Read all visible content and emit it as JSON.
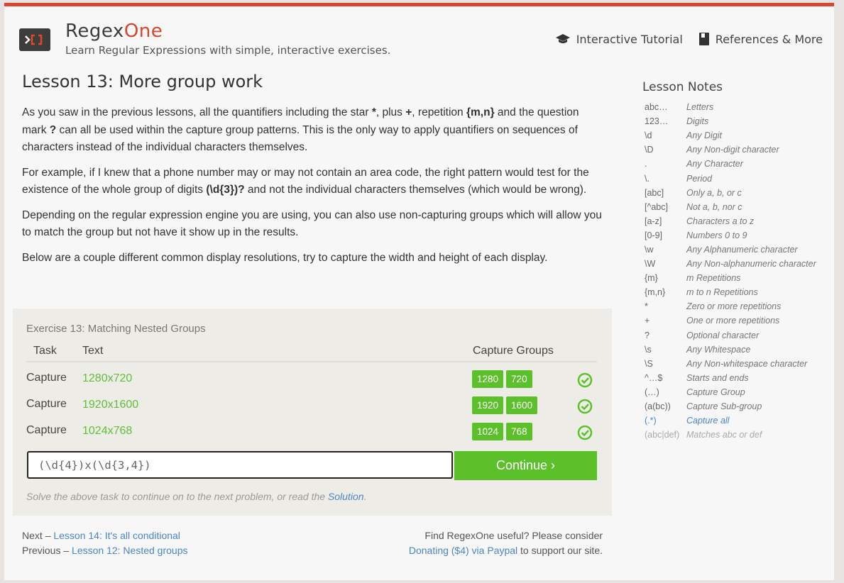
{
  "header": {
    "brand_prefix": "Regex",
    "brand_suffix": "One",
    "tagline": "Learn Regular Expressions with simple, interactive exercises.",
    "nav": [
      {
        "label": "Interactive Tutorial",
        "icon": "graduation-cap-icon"
      },
      {
        "label": "References & More",
        "icon": "book-icon"
      }
    ]
  },
  "lesson": {
    "title": "Lesson 13: More group work",
    "p1": {
      "a": "As you saw in the previous lessons, all the quantifiers including the star ",
      "b1": "*",
      "c": ", plus ",
      "b2": "+",
      "d": ", repetition ",
      "b3": "{m,n}",
      "e": " and the question mark ",
      "b4": "?",
      "f": " can all be used within the capture group patterns. This is the only way to apply quantifiers on sequences of characters instead of the individual characters themselves."
    },
    "p2": {
      "a": "For example, if I knew that a phone number may or may not contain an area code, the right pattern would test for the existence of the whole group of digits ",
      "b": "(\\d{3})?",
      "c": " and not the individual characters themselves (which would be wrong)."
    },
    "p3": "Depending on the regular expression engine you are using, you can also use non-capturing groups which will allow you to match the group but not have it show up in the results.",
    "p4": "Below are a couple different common display resolutions, try to capture the width and height of each display."
  },
  "exercise": {
    "title": "Exercise 13: Matching Nested Groups",
    "col_task": "Task",
    "col_text": "Text",
    "col_groups": "Capture Groups",
    "rows": [
      {
        "task": "Capture",
        "text": "1280x720",
        "g1": "1280",
        "g2": "720"
      },
      {
        "task": "Capture",
        "text": "1920x1600",
        "g1": "1920",
        "g2": "1600"
      },
      {
        "task": "Capture",
        "text": "1024x768",
        "g1": "1024",
        "g2": "768"
      }
    ],
    "answer_value": "(\\d{4})x(\\d{3,4})",
    "continue_label": "Continue ›",
    "solve_text": "Solve the above task to continue on to the next problem, or read the ",
    "solution_link": "Solution",
    "solve_end": ".",
    "status_color": "#5cc02b"
  },
  "footer": {
    "next_prefix": "Next – ",
    "next_link": "Lesson 14: It's all conditional",
    "prev_prefix": "Previous – ",
    "prev_link": "Lesson 12: Nested groups",
    "useful": "Find RegexOne useful? Please consider",
    "donate_link": "Donating ($4) via Paypal",
    "donate_suffix": " to support our site."
  },
  "notes": {
    "title": "Lesson Notes",
    "items": [
      {
        "k": "abc…",
        "v": "Letters"
      },
      {
        "k": "123…",
        "v": "Digits"
      },
      {
        "k": "\\d",
        "v": "Any Digit"
      },
      {
        "k": "\\D",
        "v": "Any Non-digit character"
      },
      {
        "k": ".",
        "v": "Any Character"
      },
      {
        "k": "\\.",
        "v": "Period"
      },
      {
        "k": "[abc]",
        "v": "Only a, b, or c"
      },
      {
        "k": "[^abc]",
        "v": "Not a, b, nor c"
      },
      {
        "k": "[a-z]",
        "v": "Characters a to z"
      },
      {
        "k": "[0-9]",
        "v": "Numbers 0 to 9"
      },
      {
        "k": "\\w",
        "v": "Any Alphanumeric character"
      },
      {
        "k": "\\W",
        "v": "Any Non-alphanumeric character"
      },
      {
        "k": "{m}",
        "v": "m Repetitions"
      },
      {
        "k": "{m,n}",
        "v": "m to n Repetitions"
      },
      {
        "k": "*",
        "v": "Zero or more repetitions"
      },
      {
        "k": "+",
        "v": "One or more repetitions"
      },
      {
        "k": "?",
        "v": "Optional character"
      },
      {
        "k": "\\s",
        "v": "Any Whitespace"
      },
      {
        "k": "\\S",
        "v": "Any Non-whitespace character"
      },
      {
        "k": "^…$",
        "v": "Starts and ends"
      },
      {
        "k": "(…)",
        "v": "Capture Group"
      },
      {
        "k": "(a(bc))",
        "v": "Capture Sub-group"
      },
      {
        "k": "(.*)",
        "v": "Capture all"
      },
      {
        "k": "(abc|def)",
        "v": "Matches abc or def"
      }
    ]
  }
}
